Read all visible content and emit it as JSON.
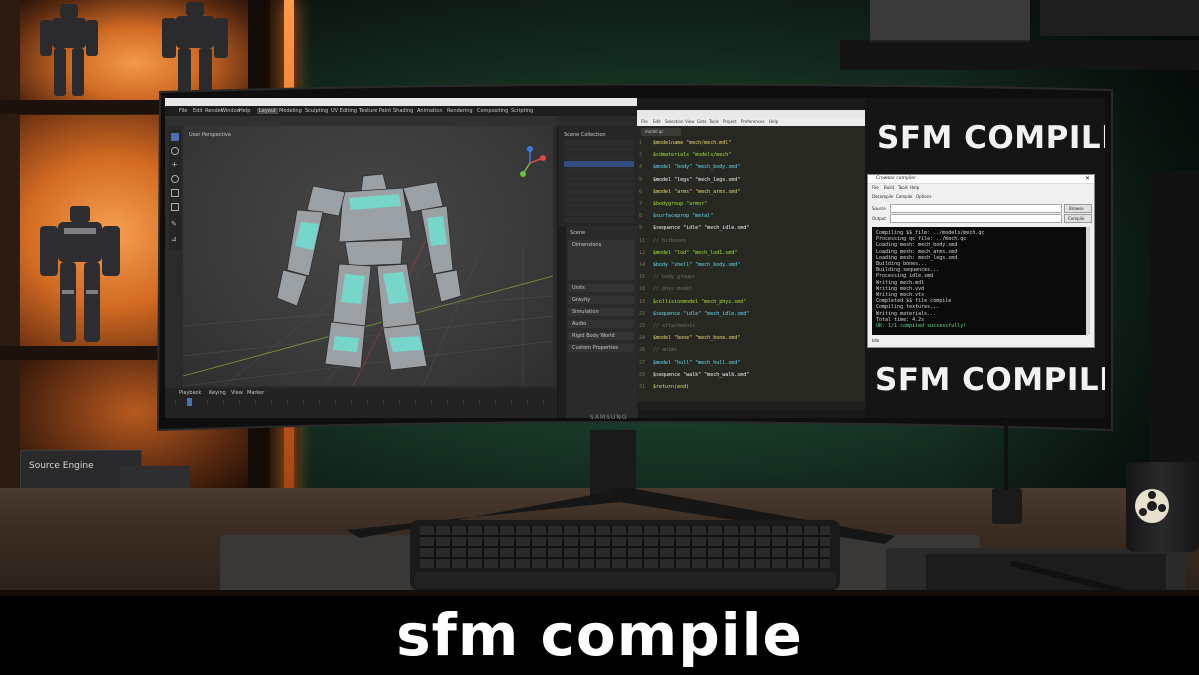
{
  "caption": "sfm compile",
  "banner_top": "SFM COMPILE",
  "banner_bottom": "SFM COMPILE",
  "shelf_box_label": "Source Engine",
  "monitor_brand": "SAMSUNG",
  "colors": {
    "wall_green": "#1f4a30",
    "shelf_glow": "#e07a2a",
    "viewport_bg": "#3a3a3a",
    "mesh_accent": "#6fe0d0",
    "terminal_bg": "#0b0b0b",
    "terminal_success": "#4fe07a"
  },
  "dialog": {
    "title": "Crowbar compiler",
    "menu": [
      "File",
      "Build",
      "Tools",
      "Help"
    ],
    "tabs": [
      "Decompile",
      "Compile",
      "Options"
    ],
    "source_label": "Source",
    "output_label": "Output",
    "browse_label": "Browse",
    "compile_label": "Compile",
    "success_line": "OK: 1/1 compiled successfully!",
    "status": "Idle"
  },
  "blender": {
    "menus": [
      "File",
      "Edit",
      "Render",
      "Window",
      "Help"
    ],
    "workspaces": [
      "Layout",
      "Modeling",
      "Sculpting",
      "UV Editing",
      "Texture Paint",
      "Shading",
      "Animation",
      "Rendering",
      "Compositing",
      "Scripting"
    ],
    "viewport_label": "User Perspective",
    "outliner_title": "Scene Collection",
    "properties_title": "Scene",
    "panels": [
      "Dimensions",
      "Units",
      "Gravity",
      "Simulation",
      "Audio",
      "Rigid Body World",
      "Custom Properties"
    ],
    "timeline_labels": [
      "Playback",
      "Keying",
      "View",
      "Marker"
    ]
  },
  "editor": {
    "menus": [
      "File",
      "Edit",
      "Selection",
      "View",
      "Goto",
      "Tools",
      "Project",
      "Preferences",
      "Help"
    ],
    "tab_title": "model.qc"
  },
  "terminal": {
    "lines": [
      "Compiling $$ file: ../models/mech.qc",
      "Processing qc file: ../mech.qc",
      "Loading mesh: mech_body.smd",
      "Loading mesh: mech_arms.smd",
      "Loading mesh: mech_legs.smd",
      "Building bones...",
      "Building sequences...",
      "Processing idle.smd",
      "Writing mech.mdl",
      "Writing mech.vvd",
      "Writing mech.vtx",
      "Completed $$ file compile",
      "Compiling textures...",
      "Writing materials...",
      "Total time: 4.2s"
    ]
  },
  "code_lines": [
    {
      "n": "1",
      "t": "$modelname \"mech/mech.mdl\""
    },
    {
      "n": "2",
      "t": "$cdmaterials \"models/mech\""
    },
    {
      "n": "4",
      "t": "$model \"body\" \"mech_body.smd\""
    },
    {
      "n": "5",
      "t": "$model \"legs\" \"mech_legs.smd\""
    },
    {
      "n": "6",
      "t": "$model \"arms\" \"mech_arms.smd\""
    },
    {
      "n": "7",
      "t": "$bodygroup \"armor\""
    },
    {
      "n": "8",
      "t": "$surfaceprop \"metal\""
    },
    {
      "n": "9",
      "t": "$sequence \"idle\" \"mech_idle.smd\""
    },
    {
      "n": "11",
      "t": "// hitboxes"
    },
    {
      "n": "12",
      "t": "$model \"lod\" \"mech_lod1.smd\""
    },
    {
      "n": "14",
      "t": "$body \"shell\" \"mech_body.smd\""
    },
    {
      "n": "16",
      "t": "// body groups"
    },
    {
      "n": "18",
      "t": "// phys model"
    },
    {
      "n": "19",
      "t": "$collisionmodel \"mech_phys.smd\""
    },
    {
      "n": "21",
      "t": "$sequence \"idle\" \"mech_idle.smd\""
    },
    {
      "n": "23",
      "t": "// attachments"
    },
    {
      "n": "24",
      "t": "$model \"bone\" \"mech_bone.smd\""
    },
    {
      "n": "26",
      "t": "// anims"
    },
    {
      "n": "27",
      "t": "$model \"hull\" \"mech_hull.smd\""
    },
    {
      "n": "29",
      "t": "$sequence \"walk\" \"mech_walk.smd\""
    },
    {
      "n": "31",
      "t": "$return(end)"
    }
  ]
}
